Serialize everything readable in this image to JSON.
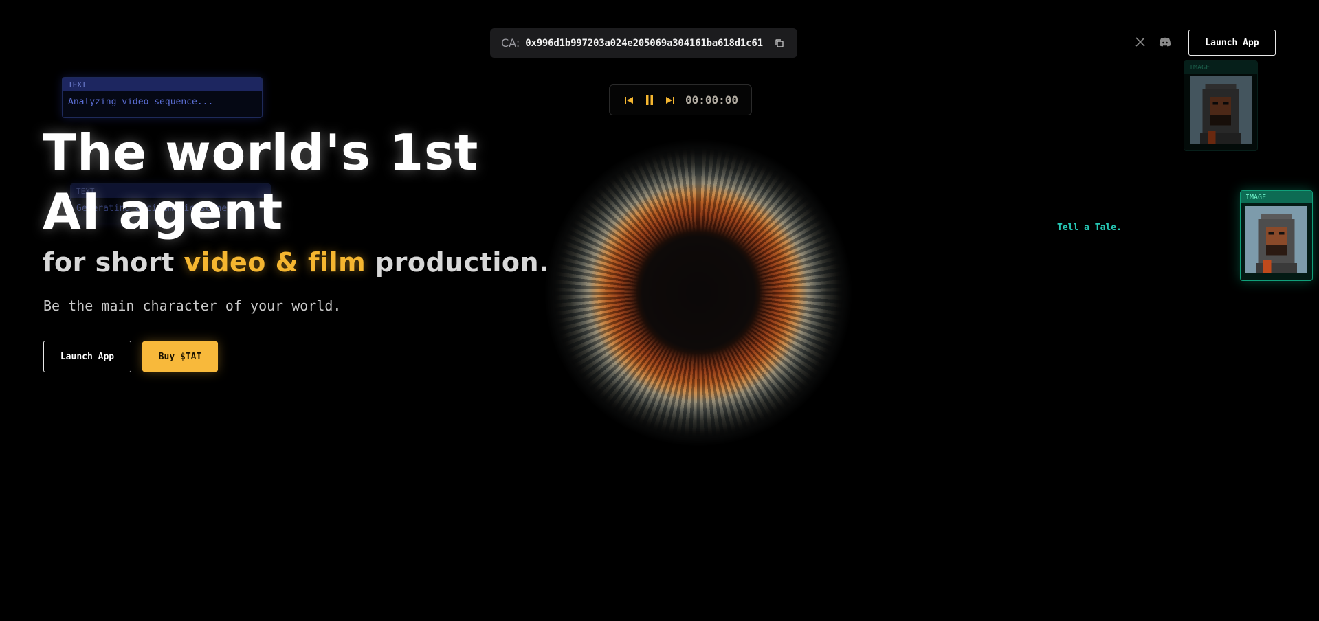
{
  "header": {
    "ca_label": "CA:",
    "ca_value": "0x996d1b997203a024e205069a304161ba618d1c61",
    "launch_label": "Launch App",
    "social": [
      "x-icon",
      "discord-icon"
    ]
  },
  "player": {
    "timecode": "00:00:00",
    "controls": [
      "skip-back-icon",
      "pause-icon",
      "skip-forward-icon"
    ]
  },
  "floating_cards": [
    {
      "header": "TEXT",
      "body": "Analyzing video sequence..."
    },
    {
      "header": "TEXT",
      "body": "Generating a cinematic scene..."
    }
  ],
  "hero": {
    "line1": "The world's 1st",
    "line2": "AI agent",
    "sub_pre": "for short ",
    "sub_accent": "video & film",
    "sub_post": " production.",
    "tagline": "Be the main character of your world.",
    "launch_label": "Launch App",
    "buy_label": "Buy $TAT"
  },
  "image_cards": [
    {
      "header": "IMAGE"
    },
    {
      "header": "IMAGE"
    }
  ],
  "tell_label": "Tell a Tale.",
  "colors": {
    "accent": "#f8b93b",
    "teal": "#26c6b4",
    "background": "#000000",
    "card_blue": "#1d2660"
  }
}
